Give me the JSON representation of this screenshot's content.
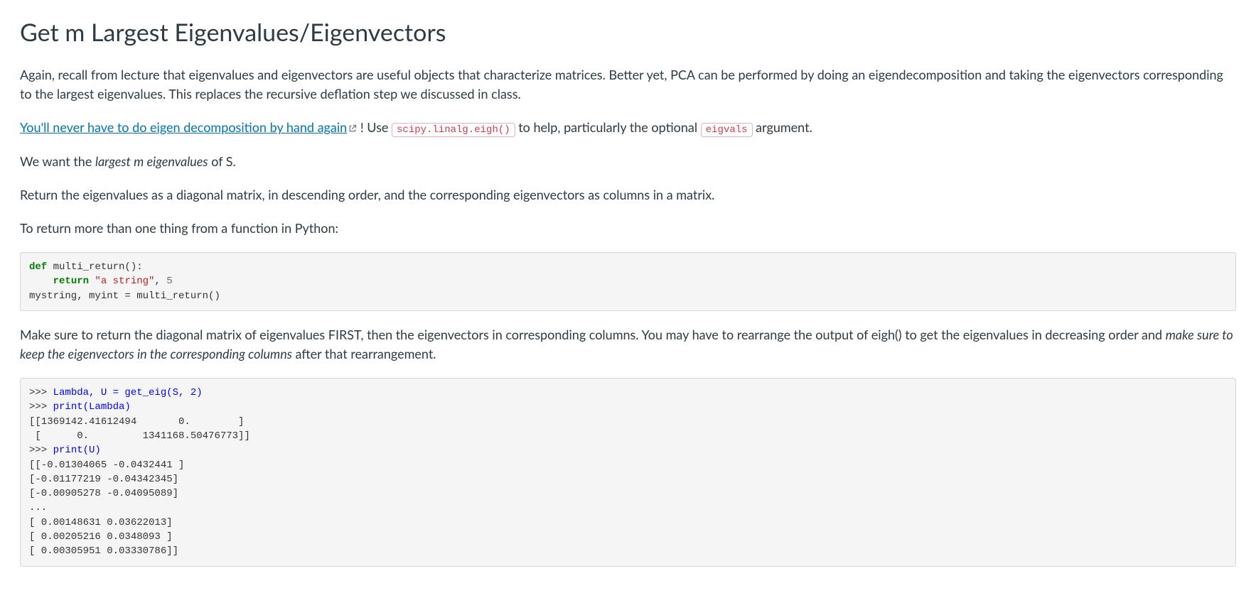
{
  "heading": "Get m Largest Eigenvalues/Eigenvectors",
  "para1": "Again, recall from lecture that eigenvalues and eigenvectors are useful objects that characterize matrices. Better yet, PCA can be performed by doing an eigendecomposition and taking the eigenvectors corresponding to the largest eigenvalues. This replaces the recursive deflation step we discussed in class.",
  "link_text": "You'll never have to do eigen decomposition by hand again",
  "para2_after_link_a": " ! Use ",
  "inline_code1": "scipy.linalg.eigh()",
  "para2_mid": " to help, particularly the optional ",
  "inline_code2": "eigvals",
  "para2_end": " argument.",
  "para3_pre": "We want the ",
  "para3_em": "largest m eigenvalues",
  "para3_post": " of S.",
  "para4": "Return the eigenvalues as a diagonal matrix, in descending order, and the corresponding eigenvectors as columns in a matrix.",
  "para5": "To return more than one thing from a function in Python:",
  "code1": {
    "kw_def": "def",
    "fn": " multi_return():",
    "kw_ret": "return",
    "str": " \"a string\"",
    "comma": ", ",
    "num5": "5",
    "assign": "mystring, myint = multi_return()"
  },
  "para6_a": "Make sure to return the diagonal matrix of eigenvalues FIRST, then the eigenvectors in corresponding columns. You may have to rearrange the output of eigh() to get the eigenvalues in decreasing order and ",
  "para6_em": "make sure to keep the eigenvectors in the corresponding columns",
  "para6_b": " after that rearrangement.",
  "code2": {
    "prompt": ">>> ",
    "l1": "Lambda, U = get_eig(S, 2)",
    "l2": "print(Lambda)",
    "l3": "[[1369142.41612494       0.        ]",
    "l4": " [      0.         1341168.50476773]]",
    "l5": "print(U)",
    "l6": "[[-0.01304065 -0.0432441 ]",
    "l7": "[-0.01177219 -0.04342345]",
    "l8": "[-0.00905278 -0.04095089]",
    "l9": "...",
    "l10": "[ 0.00148631 0.03622013]",
    "l11": "[ 0.00205216 0.0348093 ]",
    "l12": "[ 0.00305951 0.03330786]]"
  }
}
